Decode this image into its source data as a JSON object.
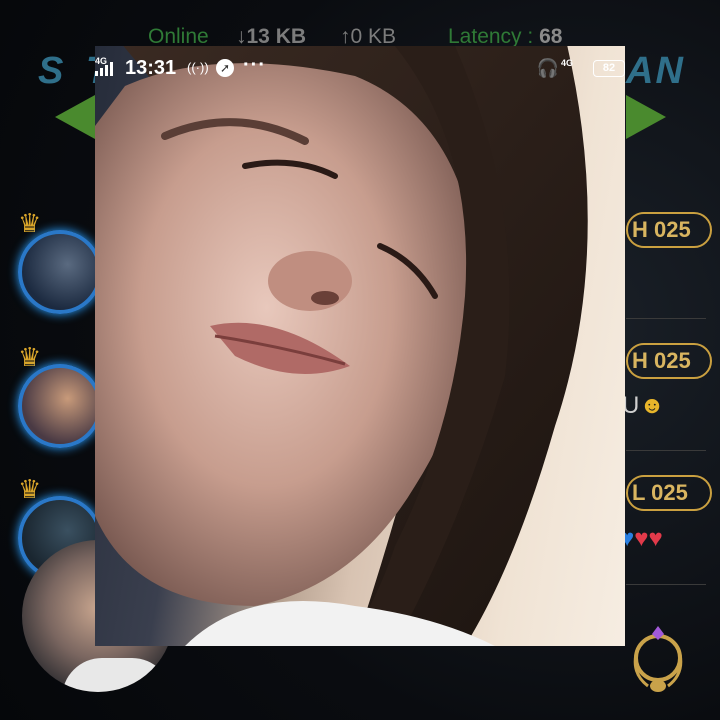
{
  "netbar": {
    "online": "Online",
    "download": "↓13 KB",
    "upload": "↑0 KB",
    "latency_label": "Latency : ",
    "latency_value": "68"
  },
  "banner": {
    "left": "S T",
    "right": "AN"
  },
  "right_column": [
    {
      "pill": "H 025",
      "line": ""
    },
    {
      "pill": "H 025",
      "line": "U"
    },
    {
      "pill": "L 025",
      "line": ""
    }
  ],
  "video_call": {
    "status_bar": {
      "network": "4G",
      "time": "13:31",
      "more": "···",
      "right_network": "4G",
      "battery": "82"
    }
  },
  "colors": {
    "online_green": "#2f7a36",
    "gold_accent": "#caa040",
    "banner_blue": "#2f6f8a"
  },
  "icons": [
    "arrow-down-icon",
    "arrow-up-icon",
    "crown-icon",
    "headphones-icon",
    "battery-icon",
    "signal-icon",
    "compass-icon",
    "wifi-call-icon",
    "smiley-emoji-icon",
    "heart-emoji-icon",
    "laurel-emblem-icon"
  ]
}
